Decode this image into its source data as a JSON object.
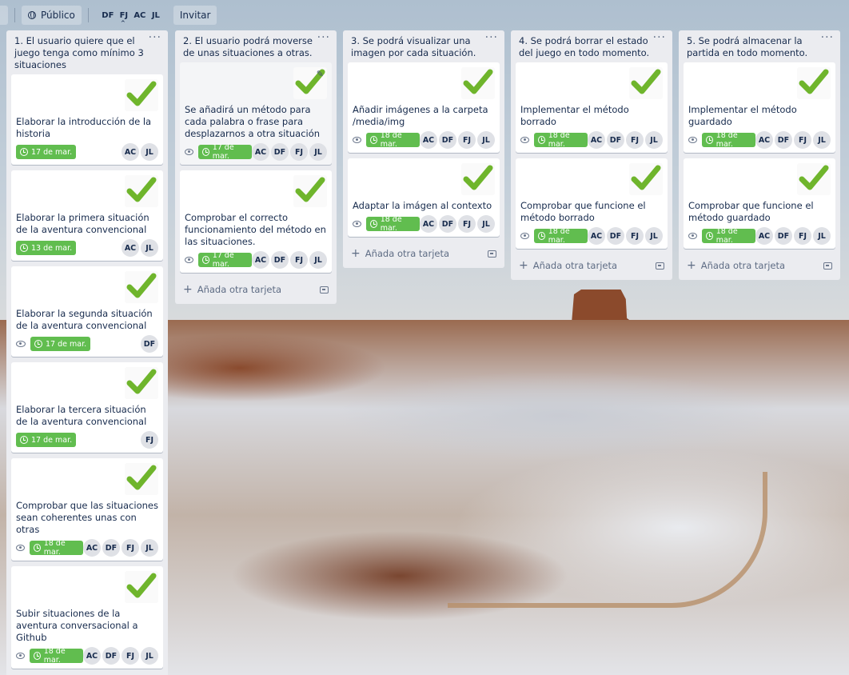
{
  "topbar": {
    "visibility_label": "Público",
    "members": [
      "DF",
      "FJ",
      "AC",
      "JL"
    ],
    "invite_label": "Invitar"
  },
  "add_card_label": "Añada otra tarjeta",
  "lists": [
    {
      "title": "1. El usuario quiere que el juego tenga como mínimo 3 situaciones",
      "cards": [
        {
          "title": "Elaborar la introducción de la historia",
          "watch": false,
          "due": "17 de mar.",
          "members": [
            "AC",
            "JL"
          ]
        },
        {
          "title": "Elaborar la primera situación de la aventura convencional",
          "watch": false,
          "due": "13 de mar.",
          "members": [
            "AC",
            "JL"
          ]
        },
        {
          "title": "Elaborar la segunda situación de la aventura convencional",
          "watch": true,
          "due": "17 de mar.",
          "members": [
            "DF"
          ]
        },
        {
          "title": "Elaborar la tercera situación de la aventura convencional",
          "watch": false,
          "due": "17 de mar.",
          "members": [
            "FJ"
          ]
        },
        {
          "title": "Comprobar que las situaciones sean coherentes unas con otras",
          "watch": true,
          "due": "18 de mar.",
          "members": [
            "AC",
            "DF",
            "FJ",
            "JL"
          ]
        },
        {
          "title": "Subir situaciones de la aventura conversacional a Github",
          "watch": true,
          "due": "18 de mar.",
          "members": [
            "AC",
            "DF",
            "FJ",
            "JL"
          ]
        }
      ]
    },
    {
      "title": "2. El usuario podrá moverse de unas situaciones a otras.",
      "cards": [
        {
          "title": "Se añadirá un método para cada palabra o frase para desplazarnos a otra situación",
          "watch": true,
          "due": "17 de mar.",
          "members": [
            "AC",
            "DF",
            "FJ",
            "JL"
          ],
          "hovered": true
        },
        {
          "title": "Comprobar el correcto funcionamiento del método en las situaciones.",
          "watch": true,
          "due": "17 de mar.",
          "members": [
            "AC",
            "DF",
            "FJ",
            "JL"
          ]
        }
      ]
    },
    {
      "title": "3. Se podrá visualizar una imagen por cada situación.",
      "cards": [
        {
          "title": "Añadir imágenes a la carpeta /media/img",
          "watch": true,
          "due": "18 de mar.",
          "members": [
            "AC",
            "DF",
            "FJ",
            "JL"
          ]
        },
        {
          "title": "Adaptar la imágen al contexto",
          "watch": true,
          "due": "18 de mar.",
          "members": [
            "AC",
            "DF",
            "FJ",
            "JL"
          ]
        }
      ]
    },
    {
      "title": "4. Se podrá borrar el estado del juego en todo momento.",
      "cards": [
        {
          "title": "Implementar el método borrado",
          "watch": true,
          "due": "18 de mar.",
          "members": [
            "AC",
            "DF",
            "FJ",
            "JL"
          ]
        },
        {
          "title": "Comprobar que funcione el método borrado",
          "watch": true,
          "due": "18 de mar.",
          "members": [
            "AC",
            "DF",
            "FJ",
            "JL"
          ]
        }
      ]
    },
    {
      "title": "5. Se podrá almacenar la partida en todo momento.",
      "cards": [
        {
          "title": "Implementar el método guardado",
          "watch": true,
          "due": "18 de mar.",
          "members": [
            "AC",
            "DF",
            "FJ",
            "JL"
          ]
        },
        {
          "title": "Comprobar que funcione el método guardado",
          "watch": true,
          "due": "18 de mar.",
          "members": [
            "AC",
            "DF",
            "FJ",
            "JL"
          ]
        }
      ]
    }
  ],
  "colors": {
    "due_complete": "#61bd4f",
    "list_bg": "#ebecf0",
    "check_green": "#6fb52c"
  },
  "icons": [
    "globe-icon",
    "checkmark-cover-icon",
    "eye-icon",
    "clock-icon",
    "plus-icon",
    "card-template-icon",
    "ellipsis-icon",
    "pencil-icon"
  ]
}
